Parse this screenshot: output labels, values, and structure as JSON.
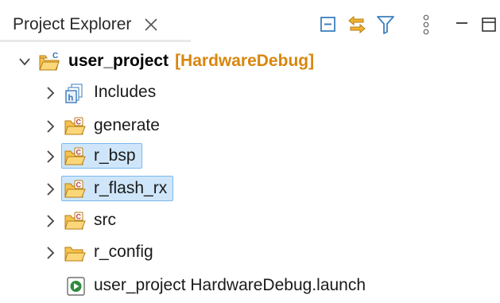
{
  "tab": {
    "title": "Project Explorer"
  },
  "project": {
    "name": "user_project",
    "config": "[HardwareDebug]"
  },
  "items": [
    {
      "label": "Includes"
    },
    {
      "label": "generate"
    },
    {
      "label": "r_bsp"
    },
    {
      "label": "r_flash_rx"
    },
    {
      "label": "src"
    },
    {
      "label": "r_config"
    },
    {
      "label": "user_project HardwareDebug.launch"
    }
  ],
  "colors": {
    "folder": "#e8a317",
    "selection": "#cfe6fa",
    "selection_border": "#7ab8ec",
    "config_tag": "#d9860f",
    "toolbar_icon": "#3d7fbf"
  },
  "icons": {
    "tab_close": "close-icon",
    "collapse_all": "collapse-all-icon",
    "link_editor": "link-with-editor-icon",
    "filter": "filter-icon",
    "view_menu": "kebab-menu-icon",
    "minimize": "minimize-icon",
    "maximize": "maximize-icon"
  }
}
